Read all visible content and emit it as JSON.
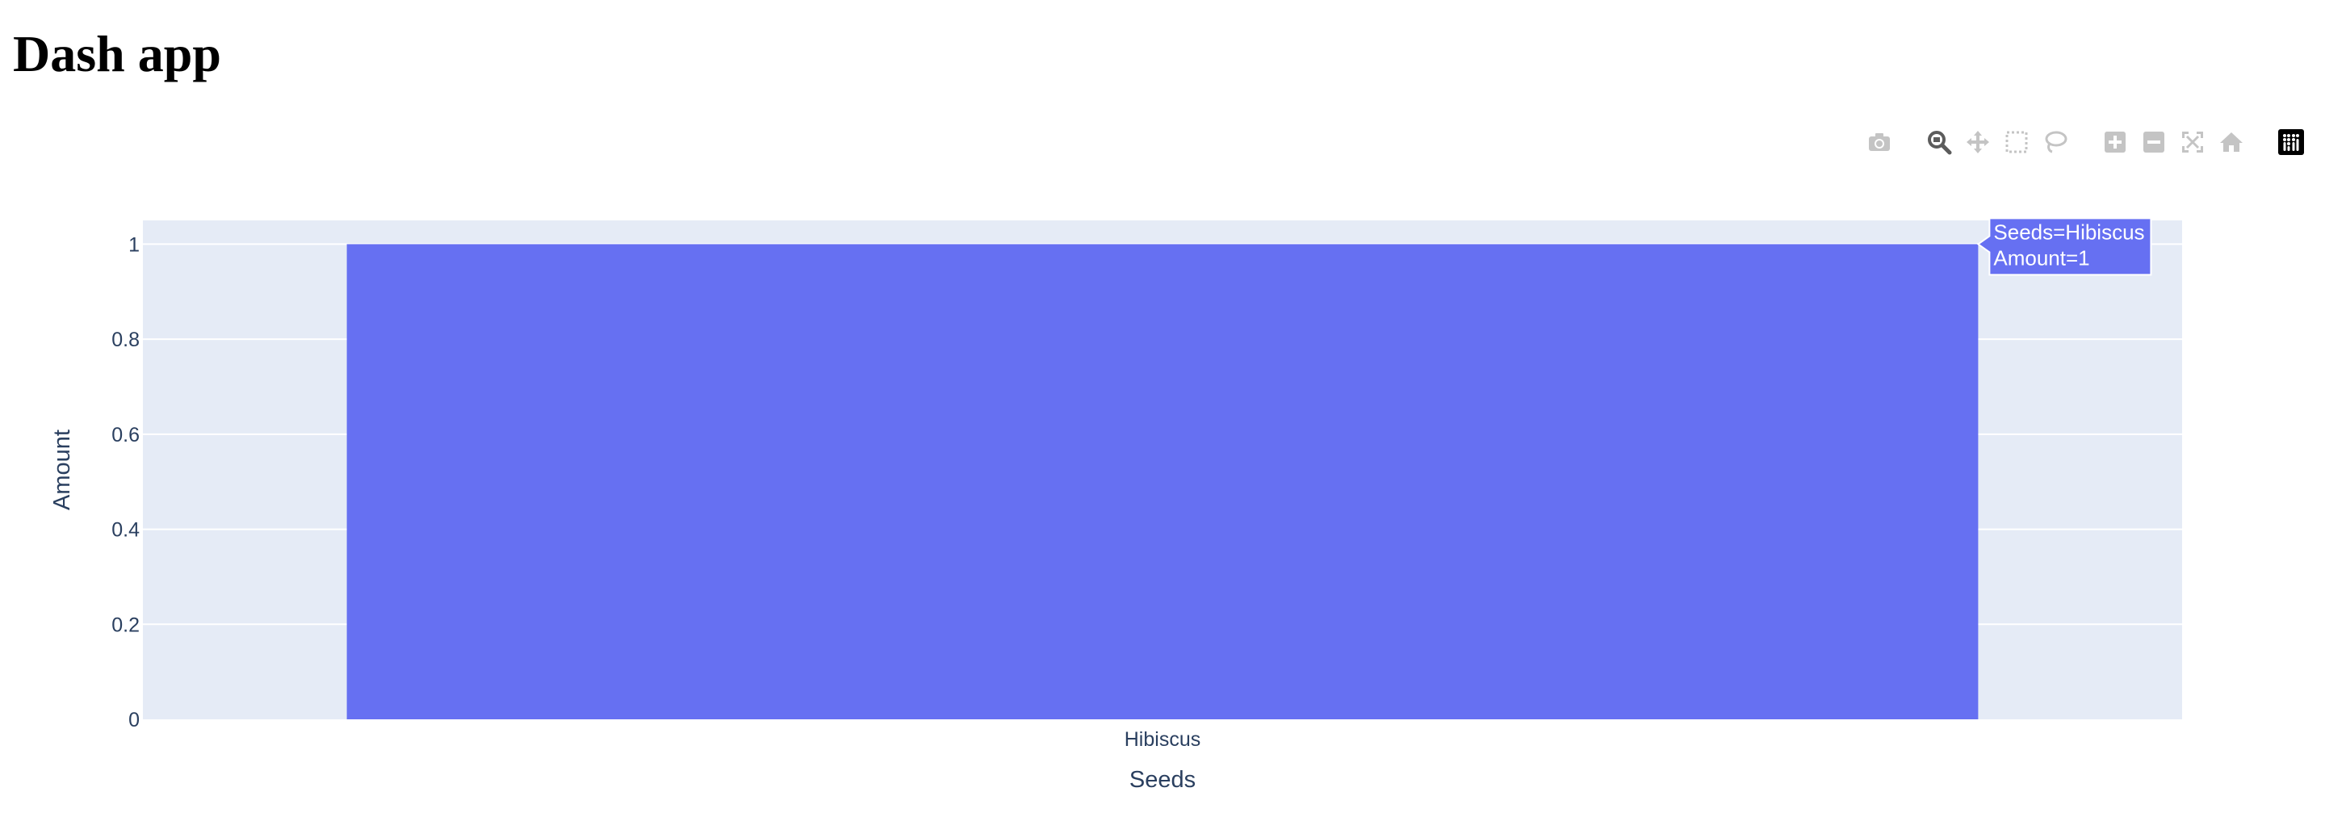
{
  "page": {
    "title": "Dash app"
  },
  "modebar": {
    "buttons": [
      {
        "name": "camera-icon",
        "group": 0,
        "active": false
      },
      {
        "name": "zoom-icon",
        "group": 1,
        "active": true
      },
      {
        "name": "pan-icon",
        "group": 1,
        "active": false
      },
      {
        "name": "box-select-icon",
        "group": 1,
        "active": false
      },
      {
        "name": "lasso-select-icon",
        "group": 1,
        "active": false
      },
      {
        "name": "zoom-in-icon",
        "group": 2,
        "active": false
      },
      {
        "name": "zoom-out-icon",
        "group": 2,
        "active": false
      },
      {
        "name": "autoscale-icon",
        "group": 2,
        "active": false
      },
      {
        "name": "reset-axes-icon",
        "group": 2,
        "active": false
      },
      {
        "name": "plotly-logo-icon",
        "group": 3,
        "active": false
      }
    ],
    "colors": {
      "icon": "#c4c4c4",
      "active": "#5c5c5c",
      "logo_bg": "#000000"
    }
  },
  "chart_data": {
    "type": "bar",
    "categories": [
      "Hibiscus"
    ],
    "values": [
      1
    ],
    "title": "",
    "xlabel": "Seeds",
    "ylabel": "Amount",
    "ylim": [
      0,
      1.05
    ],
    "yticks": [
      0,
      0.2,
      0.4,
      0.6,
      0.8,
      1
    ],
    "ytick_labels": [
      "0",
      "0.2",
      "0.4",
      "0.6",
      "0.8",
      "1"
    ],
    "grid": true,
    "colors": {
      "bar": "#6670f2",
      "plot_bg": "#e5ebf6",
      "grid": "#ffffff",
      "text": "#2a3f5f"
    },
    "hover_label": {
      "lines": [
        "Seeds=Hibiscus",
        "Amount=1"
      ]
    }
  }
}
